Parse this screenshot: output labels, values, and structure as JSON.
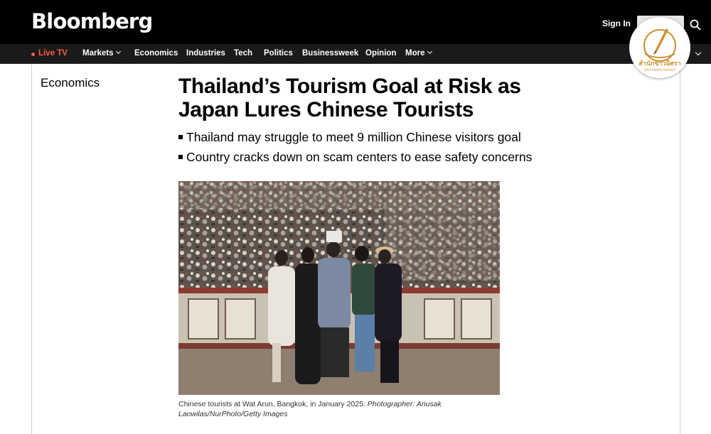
{
  "header": {
    "logo": "Bloomberg",
    "sign_in": "Sign In"
  },
  "nav": {
    "live": "Live TV",
    "items": [
      "Markets",
      "Economics",
      "Industries",
      "Tech",
      "Politics",
      "Businessweek",
      "Opinion",
      "More"
    ]
  },
  "article": {
    "section": "Economics",
    "headline": "Thailand’s Tourism Goal at Risk as Japan Lures Chinese Tourists",
    "bullets": [
      "Thailand may struggle to meet 9 million Chinese visitors goal",
      "Country cracks down on scam centers to ease safety concerns"
    ],
    "caption": "Chinese tourists at Wat Arun, Bangkok, in January 2025.",
    "credit": "Photographer: Anusak Laowilas/NurPhoto/Getty Images"
  },
  "watermark": {
    "thai_name": "สำนักข่าวอิศรา",
    "english_name": "ISRA NEWS AGENCY"
  },
  "colors": {
    "header_bg": "#000000",
    "nav_bg": "#1a1a1a",
    "live_accent": "#ff5d3d",
    "badge_gold": "#c8912e"
  },
  "icons": [
    "search-icon",
    "chevron-down-icon",
    "chevron-right-icon",
    "live-dot-icon",
    "quill-icon"
  ]
}
